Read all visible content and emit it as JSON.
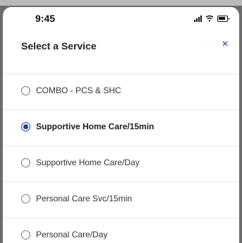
{
  "status_bar": {
    "time": "9:45",
    "signal_icon": "signal-bars-icon",
    "wifi_icon": "wifi-icon",
    "battery_icon": "battery-icon"
  },
  "sheet": {
    "title": "Select a Service",
    "close_label": "×"
  },
  "options": [
    {
      "label": "COMBO - PCS & SHC",
      "selected": false
    },
    {
      "label": "Supportive Home Care/15min",
      "selected": true
    },
    {
      "label": "Supportive Home Care/Day",
      "selected": false
    },
    {
      "label": "Personal Care Svc/15min",
      "selected": false
    },
    {
      "label": "Personal Care/Day",
      "selected": false
    }
  ],
  "colors": {
    "accent": "#1c3f94",
    "backdrop": "#6c6c6c"
  }
}
